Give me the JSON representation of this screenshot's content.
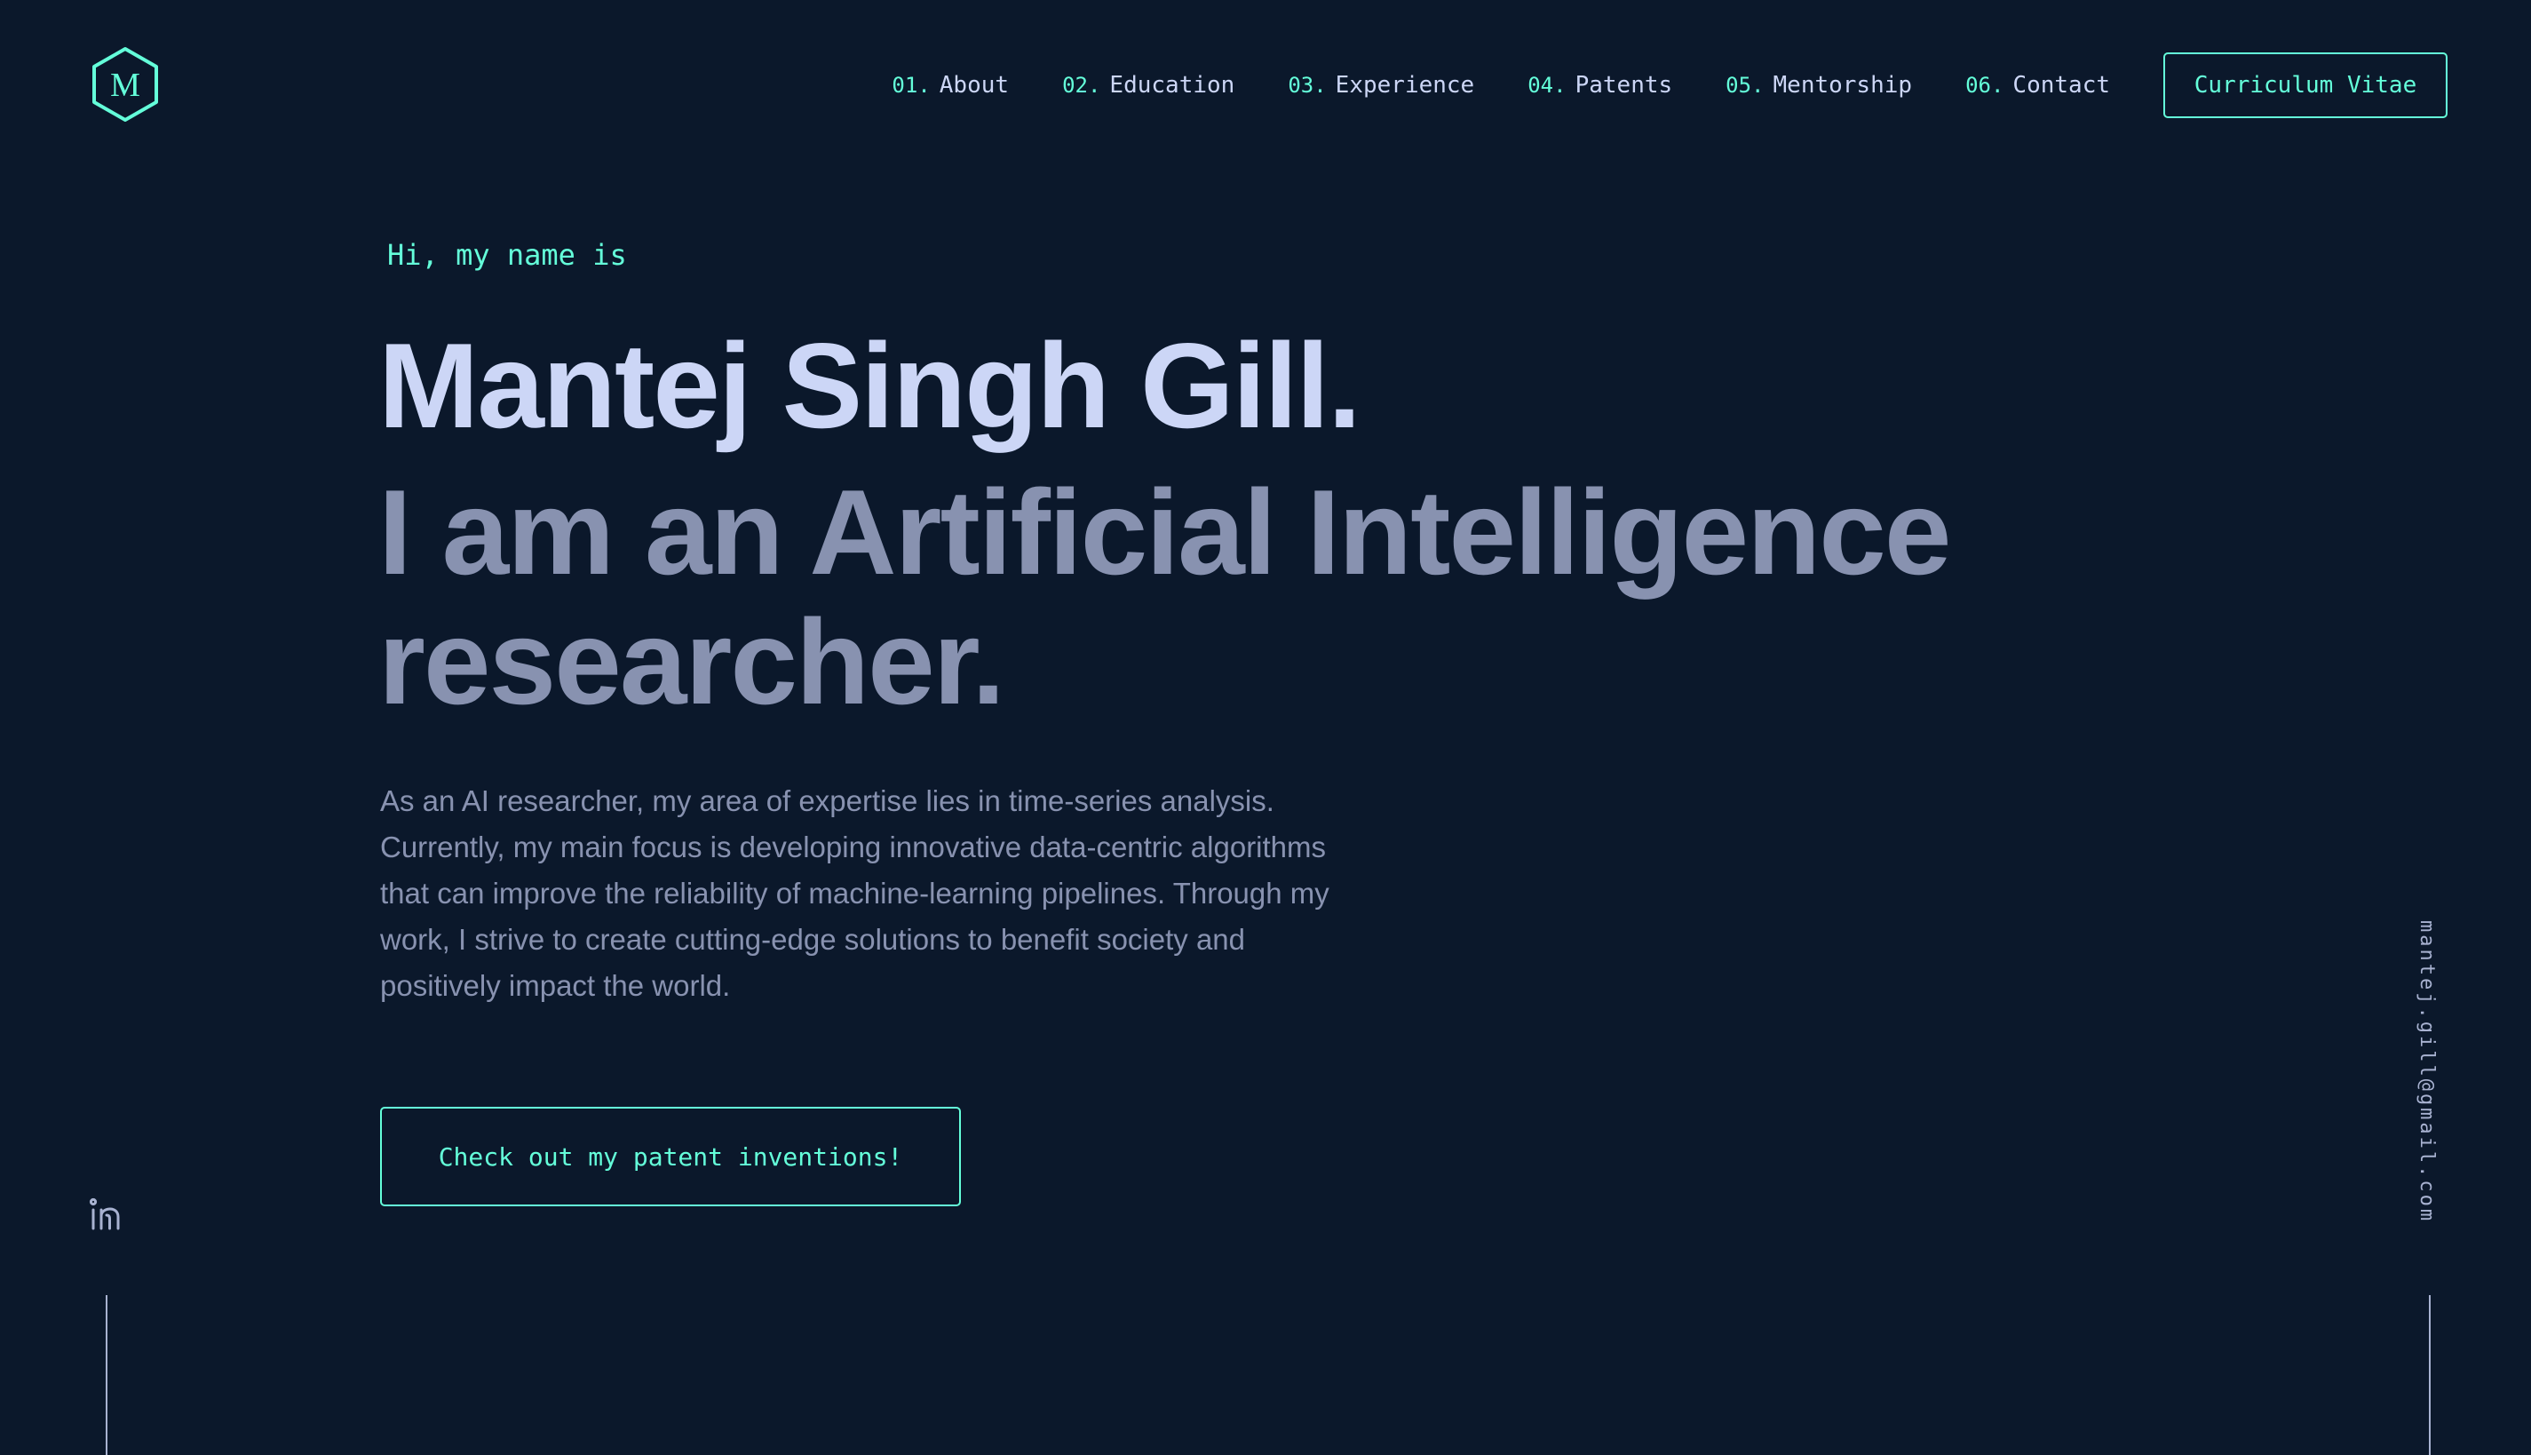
{
  "logo": {
    "letter": "M"
  },
  "nav": {
    "items": [
      {
        "num": "01.",
        "label": "About"
      },
      {
        "num": "02.",
        "label": "Education"
      },
      {
        "num": "03.",
        "label": "Experience"
      },
      {
        "num": "04.",
        "label": "Patents"
      },
      {
        "num": "05.",
        "label": "Mentorship"
      },
      {
        "num": "06.",
        "label": "Contact"
      }
    ],
    "cv_label": "Curriculum Vitae"
  },
  "hero": {
    "greeting": "Hi, my name is",
    "name": "Mantej Singh Gill.",
    "tagline": "I am an Artificial Intelligence researcher.",
    "bio": "As an AI researcher, my area of expertise lies in time-series analysis. Currently, my main focus is developing innovative data-centric algorithms that can improve the reliability of machine-learning pipelines. Through my work, I strive to create cutting-edge solutions to benefit society and positively impact the world.",
    "cta_label": "Check out my patent inventions!"
  },
  "social": {
    "icons": [
      "linkedin-icon"
    ]
  },
  "email": "mantej.gill@gmail.com",
  "colors": {
    "background": "#0b182b",
    "accent": "#64ffda",
    "heading": "#ccd6f6",
    "text": "#8892b0"
  }
}
